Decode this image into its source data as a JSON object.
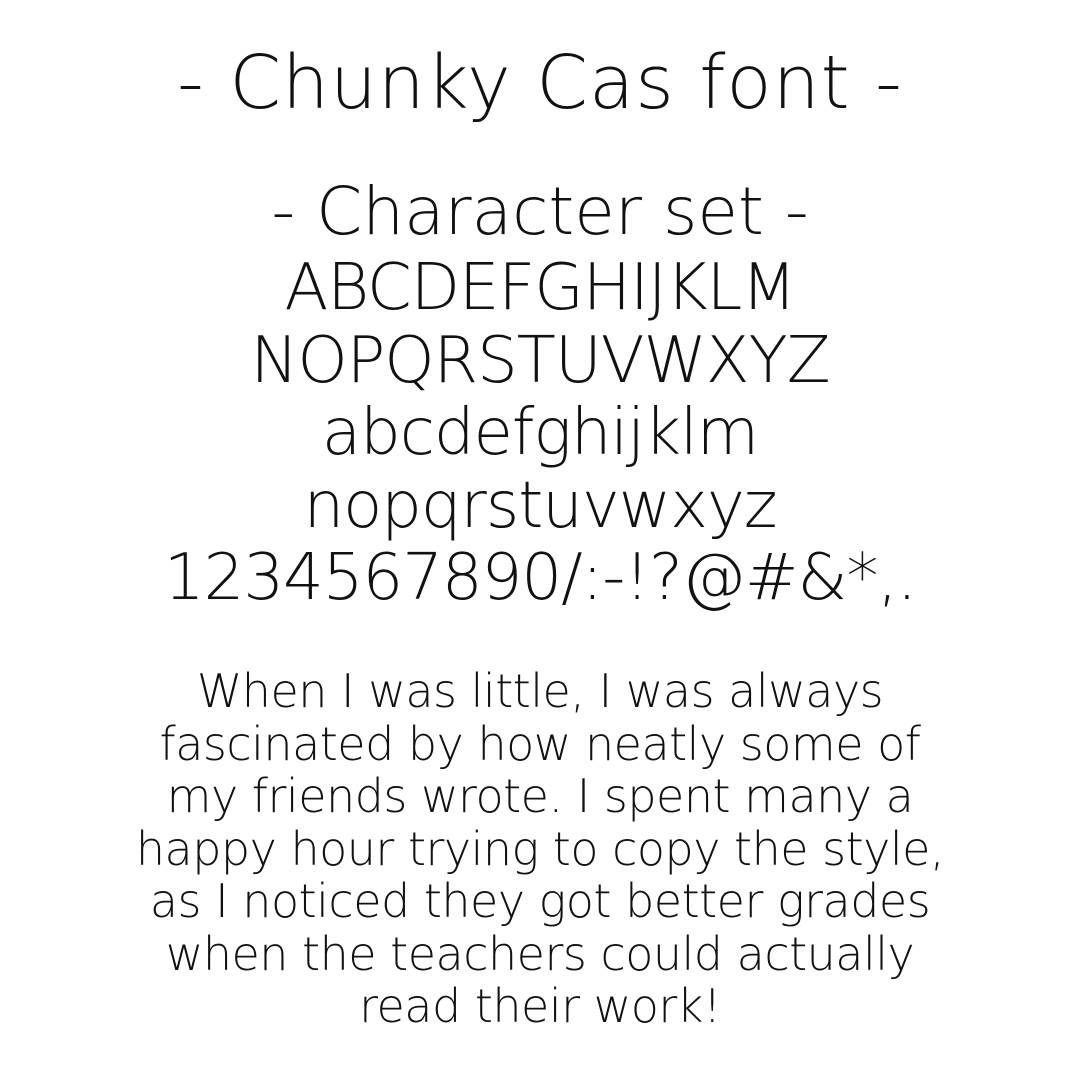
{
  "title": "- Chunky Cas font -",
  "subtitle": "- Character set -",
  "charset_lines": [
    "ABCDEFGHIJKLM",
    "NOPQRSTUVWXYZ",
    "abcdefghijklm",
    "nopqrstuvwxyz",
    "1234567890/:-!?@#&*,."
  ],
  "paragraph_lines": [
    "When I was little, I was always",
    "fascinated by how neatly some of",
    "my friends wrote. I spent many a",
    "happy hour trying to copy the style,",
    "as I noticed they got better grades",
    "when the teachers could actually",
    "read their work!"
  ]
}
